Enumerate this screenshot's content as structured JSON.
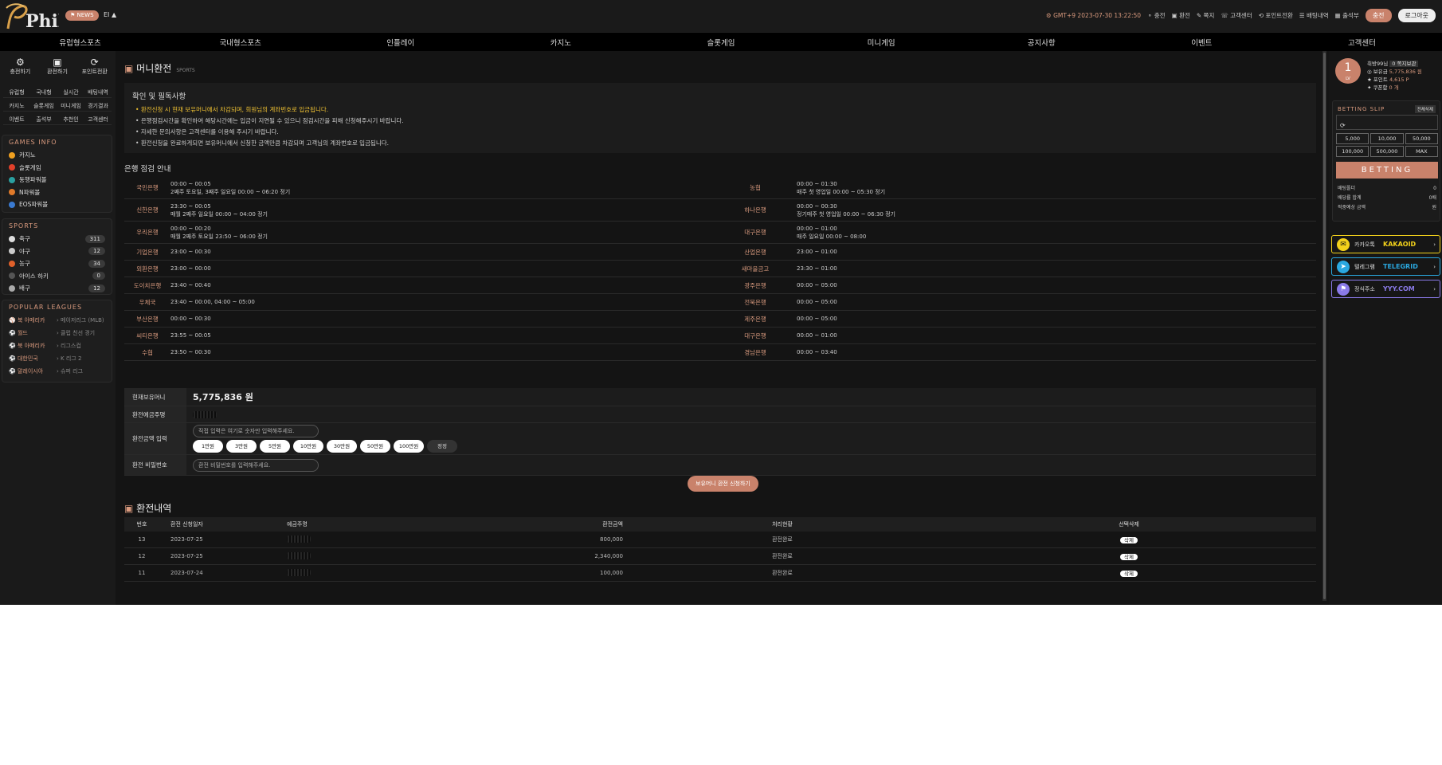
{
  "header": {
    "logo_text": "Phil",
    "news_label": "NEWS",
    "news_extra": "EI ▲",
    "time": "GMT+9 2023-07-30 13:22:50",
    "links": [
      "충전",
      "환전",
      "쪽지",
      "고객센터",
      "포인트전환",
      "배팅내역",
      "출석부"
    ],
    "charge_btn": "충전",
    "logout_btn": "로그아웃"
  },
  "nav": [
    "유럽형스포츠",
    "국내형스포츠",
    "인플레이",
    "카지노",
    "슬롯게임",
    "미니게임",
    "공지사항",
    "이벤트",
    "고객센터"
  ],
  "sidebar": {
    "quick": [
      {
        "icon": "deposit-icon",
        "label": "충전하기"
      },
      {
        "icon": "withdraw-icon",
        "label": "환전하기"
      },
      {
        "icon": "point-convert-icon",
        "label": "포인트전환"
      }
    ],
    "grid": [
      "유럽형",
      "국내형",
      "실시간",
      "배팅내역",
      "카지노",
      "슬롯게임",
      "미니게임",
      "경기결과",
      "이벤트",
      "출석부",
      "추천인",
      "고객센터"
    ],
    "games_title": "GAMES INFO",
    "games": [
      {
        "label": "카지노",
        "color": "#f0a020"
      },
      {
        "label": "슬롯게임",
        "color": "#e0402a"
      },
      {
        "label": "동행파워볼",
        "color": "#2aa0a0"
      },
      {
        "label": "N파워볼",
        "color": "#e07a2a"
      },
      {
        "label": "EOS파워볼",
        "color": "#3a7ad0"
      }
    ],
    "sports_title": "SPORTS",
    "sports": [
      {
        "label": "축구",
        "count": "311"
      },
      {
        "label": "야구",
        "count": "12"
      },
      {
        "label": "농구",
        "count": "34"
      },
      {
        "label": "아이스 하키",
        "count": "0"
      },
      {
        "label": "배구",
        "count": "12"
      }
    ],
    "leagues_title": "POPULAR LEAGUES",
    "leagues": [
      {
        "a": "북 아메리카",
        "b": "메이저리그 (MLB)"
      },
      {
        "a": "월드",
        "b": "클럽 친선 경기"
      },
      {
        "a": "북 아메리카",
        "b": "리그스컵"
      },
      {
        "a": "대한민국",
        "b": "K 리그 2"
      },
      {
        "a": "말레이시아",
        "b": "슈퍼 리그"
      }
    ]
  },
  "main": {
    "title": "머니환전",
    "title_sub": "SPORTS",
    "notice_title": "확인 및 필독사항",
    "notices": [
      "환전신청 시 현재 보유머니에서 차감되며, 회원님의 계좌번호로 입금됩니다.",
      "은행점검시간을 확인하여 해당시간에는 입금이 지연될 수 있으니 점검시간을 피해 신청해주시기 바랍니다.",
      "자세한 문의사항은 고객센터를 이용해 주시기 바랍니다.",
      "환전신청을 완료하게되면 보유머니에서 신청한 금액만큼 차감되며 고객님의 계좌번호로 입금됩니다."
    ],
    "bank_title": "은행 점검 안내",
    "banks": [
      {
        "n1": "국민은행",
        "t1a": "00:00 ~ 00:05",
        "t1b": "2째주 토요일, 3째주 일요일 00:00 ~ 06:20 정기",
        "n2": "농협",
        "t2a": "00:00 ~ 01:30",
        "t2b": "매주 첫 영업일 00:00 ~ 05:30 정기"
      },
      {
        "n1": "신한은행",
        "t1a": "23:30 ~ 00:05",
        "t1b": "매월 2째주 일요일 00:00 ~ 04:00 정기",
        "n2": "하나은행",
        "t2a": "00:00 ~ 00:30",
        "t2b": "정기매주 첫 영업일 00:00 ~ 06:30 정기"
      },
      {
        "n1": "우리은행",
        "t1a": "00:00 ~ 00:20",
        "t1b": "매월 2째주 토요일 23:50 ~ 06:00 정기",
        "n2": "대구은행",
        "t2a": "00:00 ~ 01:00",
        "t2b": "매주 일요일 00:00 ~ 08:00"
      },
      {
        "n1": "기업은행",
        "t1a": "23:00 ~ 00:30",
        "t1b": "",
        "n2": "산업은행",
        "t2a": "23:00 ~ 01:00",
        "t2b": ""
      },
      {
        "n1": "외환은행",
        "t1a": "23:00 ~ 00:00",
        "t1b": "",
        "n2": "새마을금고",
        "t2a": "23:30 ~ 01:00",
        "t2b": ""
      },
      {
        "n1": "도이치은행",
        "t1a": "23:40 ~ 00:40",
        "t1b": "",
        "n2": "광주은행",
        "t2a": "00:00 ~ 05:00",
        "t2b": ""
      },
      {
        "n1": "우체국",
        "t1a": "23:40 ~ 00:00, 04:00 ~ 05:00",
        "t1b": "",
        "n2": "전북은행",
        "t2a": "00:00 ~ 05:00",
        "t2b": ""
      },
      {
        "n1": "부산은행",
        "t1a": "00:00 ~ 00:30",
        "t1b": "",
        "n2": "제주은행",
        "t2a": "00:00 ~ 05:00",
        "t2b": ""
      },
      {
        "n1": "씨티은행",
        "t1a": "23:55 ~ 00:05",
        "t1b": "",
        "n2": "대구은행",
        "t2a": "00:00 ~ 01:00",
        "t2b": ""
      },
      {
        "n1": "수협",
        "t1a": "23:50 ~ 00:30",
        "t1b": "",
        "n2": "경남은행",
        "t2a": "00:00 ~ 03:40",
        "t2b": ""
      }
    ],
    "form": {
      "balance_label": "현재보유머니",
      "balance_value": "5,775,836 원",
      "account_label": "환전예금주명",
      "amount_label": "환전금액 입력",
      "amount_placeholder": "직접 입력은 여기로 숫자만 입력해주세요.",
      "amount_buttons": [
        "1만원",
        "3만원",
        "5만원",
        "10만원",
        "30만원",
        "50만원",
        "100만원"
      ],
      "reset_label": "정정",
      "password_label": "환전 비밀번호",
      "password_placeholder": "환전 비밀번호를 입력해주세요.",
      "submit": "보유머니 환전 신청하기"
    },
    "history_title": "환전내역",
    "history_headers": [
      "번호",
      "환전 신청일자",
      "예금주명",
      "환전금액",
      "처리현황",
      "선택삭제"
    ],
    "history": [
      {
        "no": "13",
        "date": "2023-07-25",
        "amount": "800,000",
        "status": "환전완료",
        "del": "삭제"
      },
      {
        "no": "12",
        "date": "2023-07-25",
        "amount": "2,340,000",
        "status": "환전완료",
        "del": "삭제"
      },
      {
        "no": "11",
        "date": "2023-07-24",
        "amount": "100,000",
        "status": "환전완료",
        "del": "삭제"
      }
    ]
  },
  "right": {
    "level": "1",
    "level_sub": "LV",
    "username": "취방99님",
    "msg_badge": "0 쪽지보관",
    "money_label": "보유금",
    "money": "5,775,836 원",
    "point_label": "포인트",
    "point": "4,615 P",
    "coupon_label": "쿠폰함",
    "coupon": "0 개",
    "slip_title": "BETTING SLIP",
    "slip_tag": "전체삭제",
    "chips": [
      "5,000",
      "10,000",
      "50,000",
      "100,000",
      "500,000",
      "MAX"
    ],
    "bet_btn": "BETTING",
    "slip_rows": [
      {
        "k": "배팅폴더",
        "v": "0"
      },
      {
        "k": "배당률 합계",
        "v": "0배"
      },
      {
        "k": "적중예상 금액",
        "v": "원"
      }
    ],
    "socials": [
      {
        "icon": "kakao-icon",
        "label": "카카오톡",
        "handle": "KAKAOID",
        "color": "#f2d11b"
      },
      {
        "icon": "telegram-icon",
        "label": "텔레그램",
        "handle": "TELEGRID",
        "color": "#2aa8e0"
      },
      {
        "icon": "flag-icon",
        "label": "정식주소",
        "handle": "YYY.COM",
        "color": "#8a7ae8"
      }
    ]
  }
}
